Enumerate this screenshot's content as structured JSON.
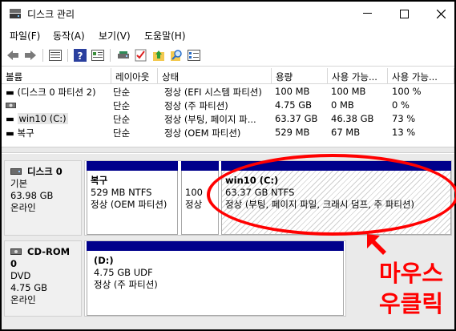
{
  "window": {
    "title": "디스크 관리"
  },
  "menu": {
    "file": "파일(F)",
    "action": "동작(A)",
    "view": "보기(V)",
    "help": "도움말(H)"
  },
  "toolbar": {
    "icons": [
      "back-arrow-icon",
      "forward-arrow-icon",
      "list-view-icon",
      "help-icon",
      "properties-icon",
      "disk-icon",
      "check-icon",
      "up-folder-icon",
      "search-icon",
      "settings-list-icon"
    ]
  },
  "volume_table": {
    "columns": [
      "볼륨",
      "레이아웃",
      "상태",
      "용량",
      "사용 가능...",
      "사용 가능..."
    ],
    "rows": [
      {
        "volume": "(디스크 0 파티션 2)",
        "layout": "단순",
        "status": "정상 (EFI 시스템 파티션)",
        "capacity": "100 MB",
        "free": "100 MB",
        "percent": "100 %"
      },
      {
        "volume": "",
        "layout": "단순",
        "status": "정상 (주 파티션)",
        "capacity": "4.75 GB",
        "free": "0 MB",
        "percent": "0 %"
      },
      {
        "volume": "win10 (C:)",
        "layout": "단순",
        "status": "정상 (부팅, 페이지 파...",
        "capacity": "63.37 GB",
        "free": "46.38 GB",
        "percent": "73 %"
      },
      {
        "volume": "복구",
        "layout": "단순",
        "status": "정상 (OEM 파티션)",
        "capacity": "529 MB",
        "free": "67 MB",
        "percent": "13 %"
      }
    ]
  },
  "disk0": {
    "name": "디스크 0",
    "type": "기본",
    "size": "63.98 GB",
    "state": "온라인",
    "partitions": {
      "recovery": {
        "name": "복구",
        "size": "529 MB NTFS",
        "status": "정상 (OEM 파티션)"
      },
      "efi": {
        "size": "100",
        "status": "정상"
      },
      "c": {
        "name": "win10  (C:)",
        "size": "63.37 GB NTFS",
        "status": "정상 (부팅, 페이지 파일, 크래시 덤프, 주 파티션)"
      }
    }
  },
  "cdrom0": {
    "name": "CD-ROM 0",
    "type": "DVD",
    "size": "4.75 GB",
    "state": "온라인",
    "partition": {
      "name": "(D:)",
      "size": "4.75 GB UDF",
      "status": "정상 (주 파티션)"
    }
  },
  "annotation": {
    "line1": "마우스",
    "line2": "우클릭",
    "color": "#ff0000"
  },
  "colors": {
    "partition_bar": "#00008b",
    "annotation": "#ff0000"
  }
}
